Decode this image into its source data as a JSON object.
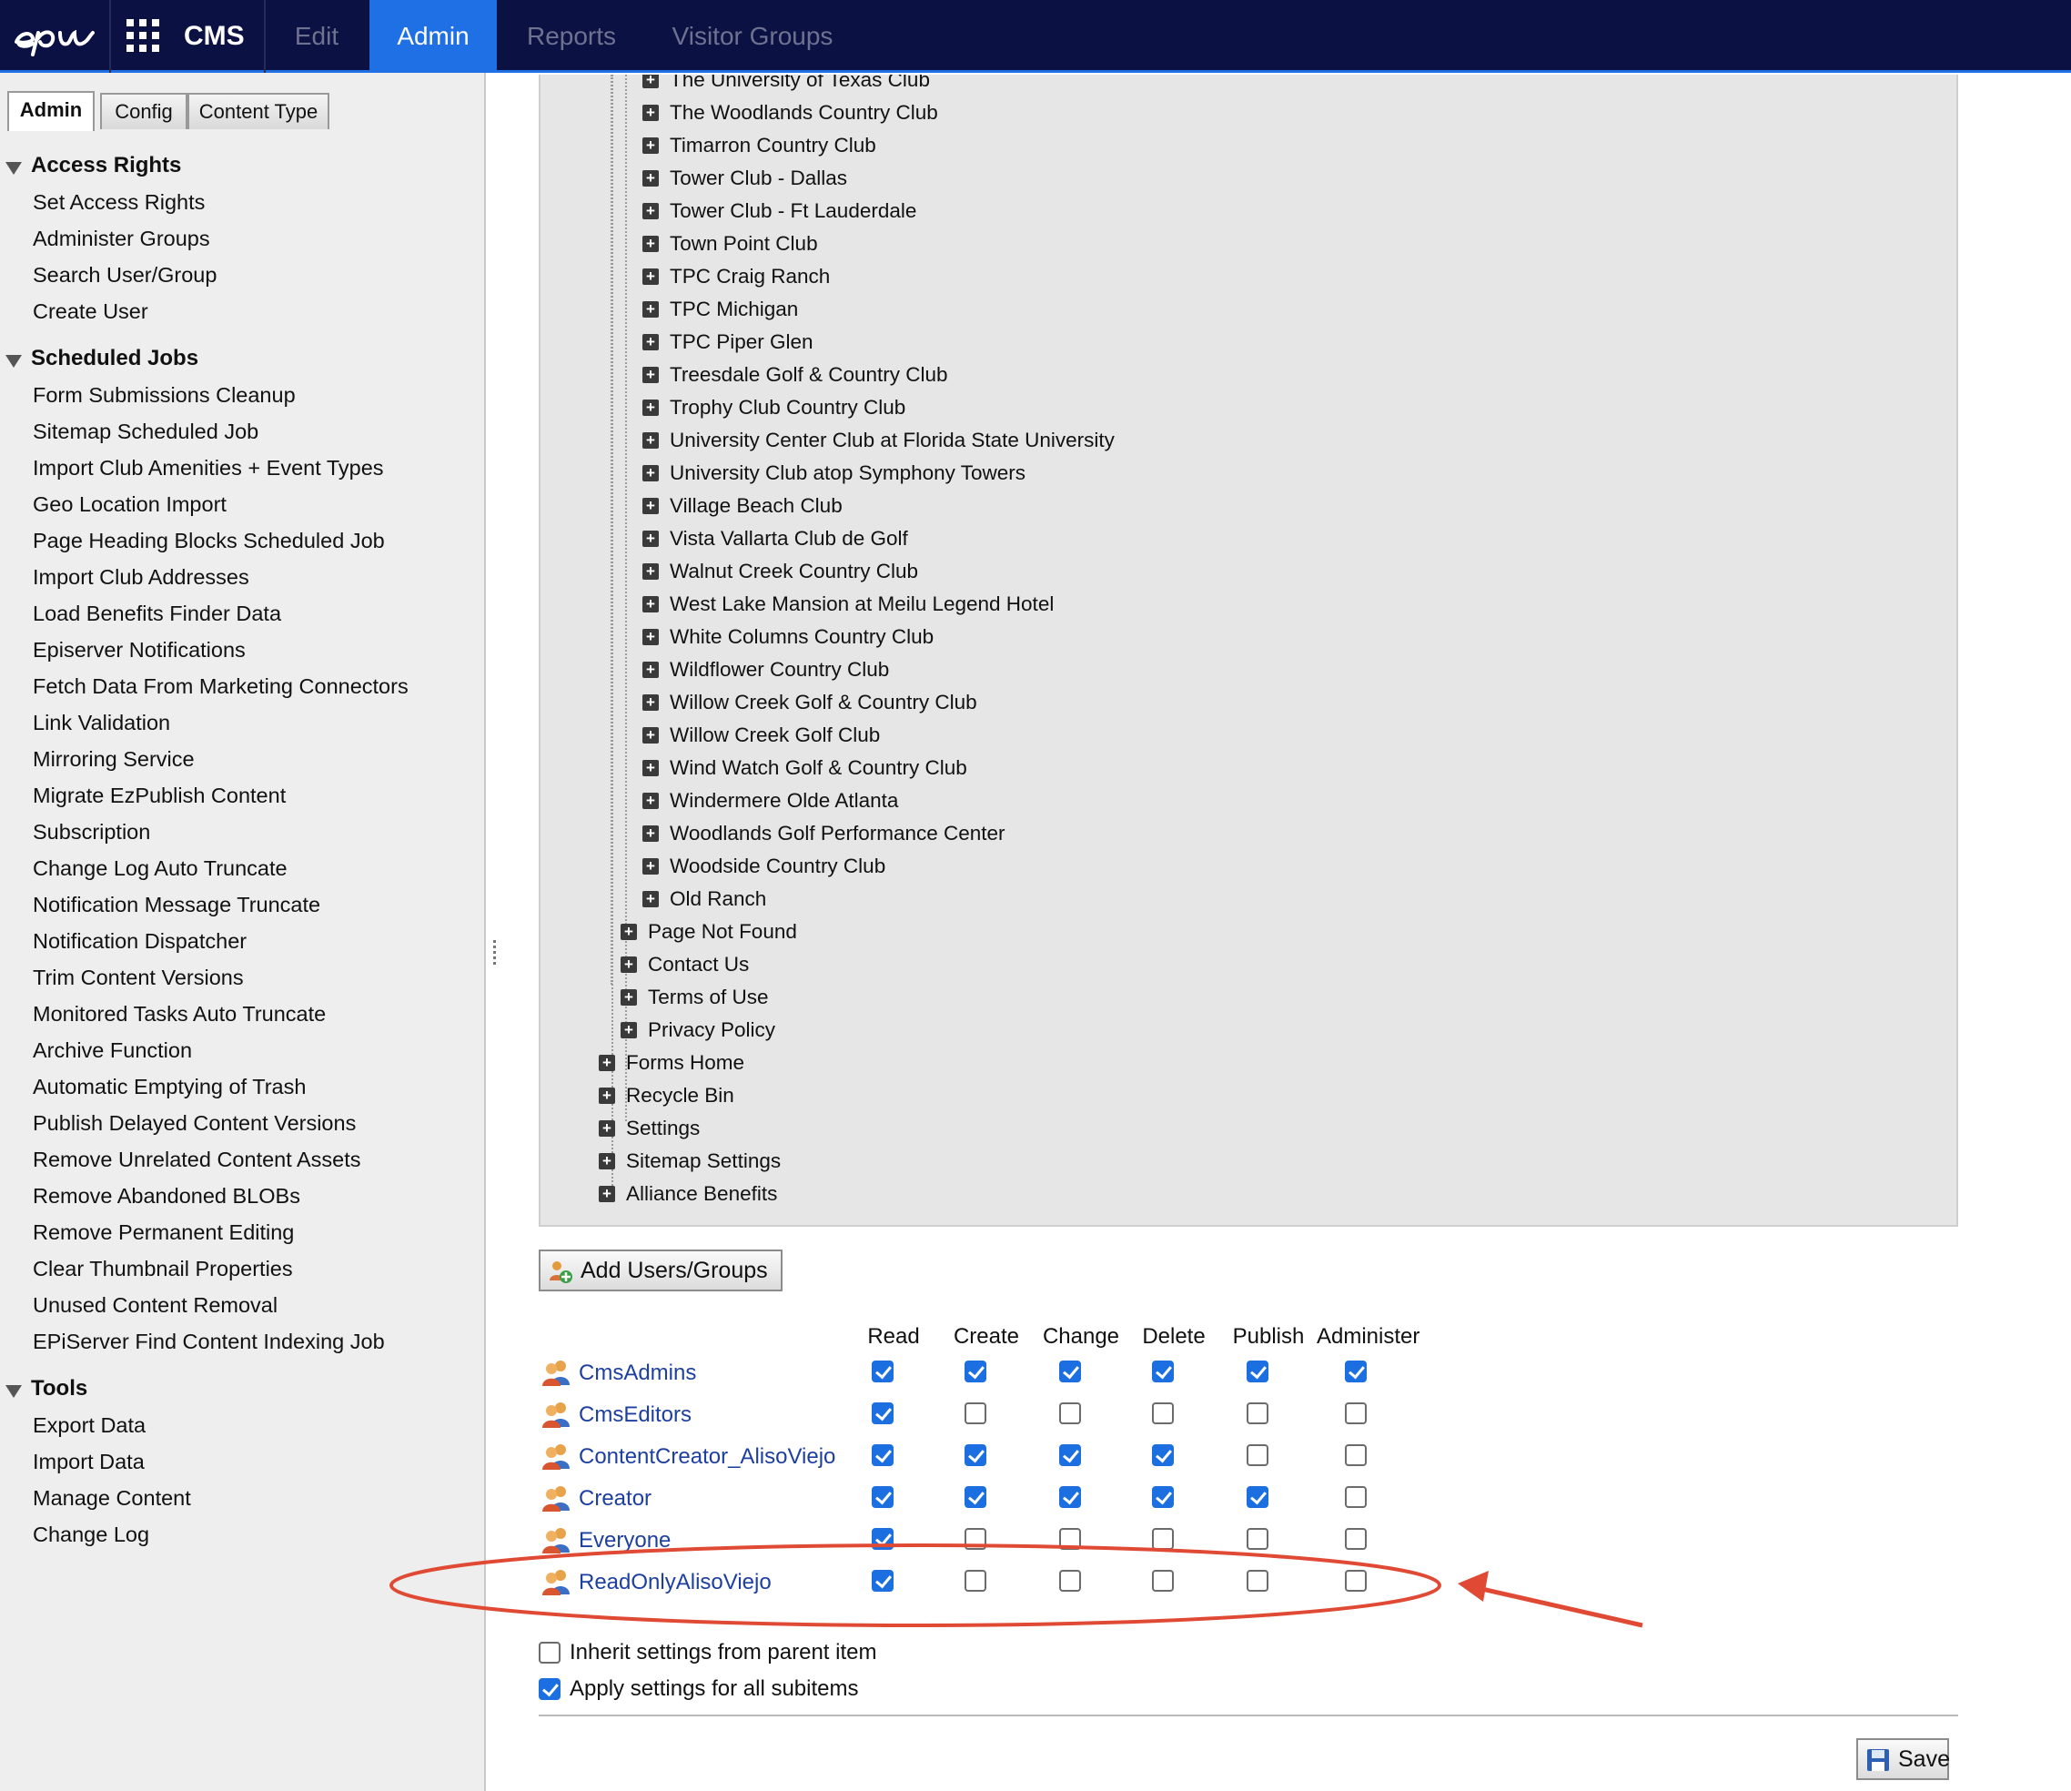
{
  "header": {
    "app_name": "CMS",
    "tabs": [
      {
        "label": "Edit",
        "active": false
      },
      {
        "label": "Admin",
        "active": true
      },
      {
        "label": "Reports",
        "active": false
      },
      {
        "label": "Visitor Groups",
        "active": false
      }
    ],
    "accent": "#1f6fe5",
    "background": "#0b1142"
  },
  "sidebar": {
    "tabs": [
      {
        "label": "Admin",
        "active": true
      },
      {
        "label": "Config",
        "active": false
      },
      {
        "label": "Content Type",
        "active": false
      }
    ],
    "sections": [
      {
        "title": "Access Rights",
        "items": [
          "Set Access Rights",
          "Administer Groups",
          "Search User/Group",
          "Create User"
        ]
      },
      {
        "title": "Scheduled Jobs",
        "items": [
          "Form Submissions Cleanup",
          "Sitemap Scheduled Job",
          "Import Club Amenities + Event Types",
          "Geo Location Import",
          "Page Heading Blocks Scheduled Job",
          "Import Club Addresses",
          "Load Benefits Finder Data",
          "Episerver Notifications",
          "Fetch Data From Marketing Connectors",
          "Link Validation",
          "Mirroring Service",
          "Migrate EzPublish Content",
          "Subscription",
          "Change Log Auto Truncate",
          "Notification Message Truncate",
          "Notification Dispatcher",
          "Trim Content Versions",
          "Monitored Tasks Auto Truncate",
          "Archive Function",
          "Automatic Emptying of Trash",
          "Publish Delayed Content Versions",
          "Remove Unrelated Content Assets",
          "Remove Abandoned BLOBs",
          "Remove Permanent Editing",
          "Clear Thumbnail Properties",
          "Unused Content Removal",
          "EPiServer Find Content Indexing Job"
        ]
      },
      {
        "title": "Tools",
        "items": [
          "Export Data",
          "Import Data",
          "Manage Content",
          "Change Log"
        ]
      }
    ]
  },
  "tree": {
    "clubs": [
      "The University of Texas Club",
      "The Woodlands Country Club",
      "Timarron Country Club",
      "Tower Club - Dallas",
      "Tower Club - Ft Lauderdale",
      "Town Point Club",
      "TPC Craig Ranch",
      "TPC Michigan",
      "TPC Piper Glen",
      "Treesdale Golf & Country Club",
      "Trophy Club Country Club",
      "University Center Club at Florida State University",
      "University Club atop Symphony Towers",
      "Village Beach Club",
      "Vista Vallarta Club de Golf",
      "Walnut Creek Country Club",
      "West Lake Mansion at Meilu Legend Hotel",
      "White Columns Country Club",
      "Wildflower Country Club",
      "Willow Creek Golf & Country Club",
      "Willow Creek Golf Club",
      "Wind Watch Golf & Country Club",
      "Windermere Olde Atlanta",
      "Woodlands Golf Performance Center",
      "Woodside Country Club",
      "Old Ranch"
    ],
    "pages": [
      "Page Not Found",
      "Contact Us",
      "Terms of Use",
      "Privacy Policy"
    ],
    "roots": [
      "Forms Home",
      "Recycle Bin",
      "Settings",
      "Sitemap Settings",
      "Alliance Benefits"
    ]
  },
  "permissions": {
    "add_button_label": "Add Users/Groups",
    "columns": [
      "Read",
      "Create",
      "Change",
      "Delete",
      "Publish",
      "Administer"
    ],
    "groups": [
      {
        "name": "CmsAdmins",
        "rights": [
          true,
          true,
          true,
          true,
          true,
          true
        ]
      },
      {
        "name": "CmsEditors",
        "rights": [
          true,
          false,
          false,
          false,
          false,
          false
        ]
      },
      {
        "name": "ContentCreator_AlisoViejo",
        "rights": [
          true,
          true,
          true,
          true,
          false,
          false
        ]
      },
      {
        "name": "Creator",
        "rights": [
          true,
          true,
          true,
          true,
          true,
          false
        ]
      },
      {
        "name": "Everyone",
        "rights": [
          true,
          false,
          false,
          false,
          false,
          false
        ]
      },
      {
        "name": "ReadOnlyAlisoViejo",
        "rights": [
          true,
          false,
          false,
          false,
          false,
          false
        ],
        "highlighted": true
      }
    ],
    "options": [
      {
        "label": "Inherit settings from parent item",
        "checked": false
      },
      {
        "label": "Apply settings for all subitems",
        "checked": true
      }
    ],
    "save_label": "Save",
    "annotation_color": "#e04a35"
  }
}
